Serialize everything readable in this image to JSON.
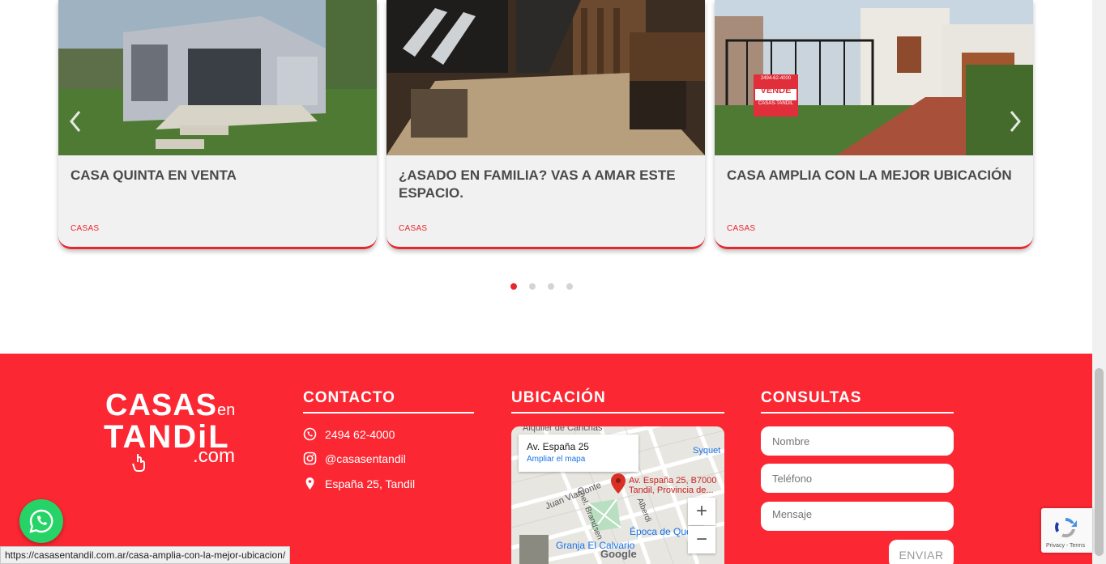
{
  "carousel": {
    "cards": [
      {
        "title": "CASA QUINTA EN VENTA",
        "category": "CASAS"
      },
      {
        "title": "¿ASADO EN FAMILIA? VAS A AMAR ESTE ESPACIO.",
        "category": "CASAS"
      },
      {
        "title": "CASA AMPLIA CON LA MEJOR UBICACIÓN",
        "category": "CASAS"
      }
    ],
    "prev_icon": "chevron-left-icon",
    "next_icon": "chevron-right-icon",
    "dots_total": 4,
    "dots_active": 1,
    "sign_text": {
      "phone": "2494-62-4000",
      "word": "VENDE",
      "brand": "CASAS-TANDIL"
    }
  },
  "footer": {
    "logo": {
      "line1": "CASAS",
      "line1_small": "en",
      "line2": "TANDiL",
      "line3": ".com"
    },
    "contact": {
      "heading": "CONTACTO",
      "phone": "2494 62-4000",
      "instagram": "@casasentandil",
      "address": "España 25, Tandil"
    },
    "location": {
      "heading": "UBICACIÓN",
      "map": {
        "info_address": "Av. España 25",
        "info_link": "Ampliar el mapa",
        "pin_label_line1": "Av. España 25, B7000",
        "pin_label_line2": "Tandil, Provincia de...",
        "labels": [
          "Alquiler de Canchas",
          "Syquet",
          "Juan Viamonte",
          "Cnel. Brandsen",
          "Alberdi",
          "Granja El Calvario",
          "Época de Que"
        ],
        "zoom_in": "+",
        "zoom_out": "−",
        "google": "Google"
      }
    },
    "form": {
      "heading": "CONSULTAS",
      "name_placeholder": "Nombre",
      "phone_placeholder": "Teléfono",
      "message_placeholder": "Mensaje",
      "send_label": "ENVIAR"
    }
  },
  "status_bar_url": "https://casasentandil.com.ar/casa-amplia-con-la-mejor-ubicacion/",
  "recaptcha_terms": "Privacy - Terms",
  "colors": {
    "accent": "#fb2833",
    "whatsapp": "#25d366"
  }
}
